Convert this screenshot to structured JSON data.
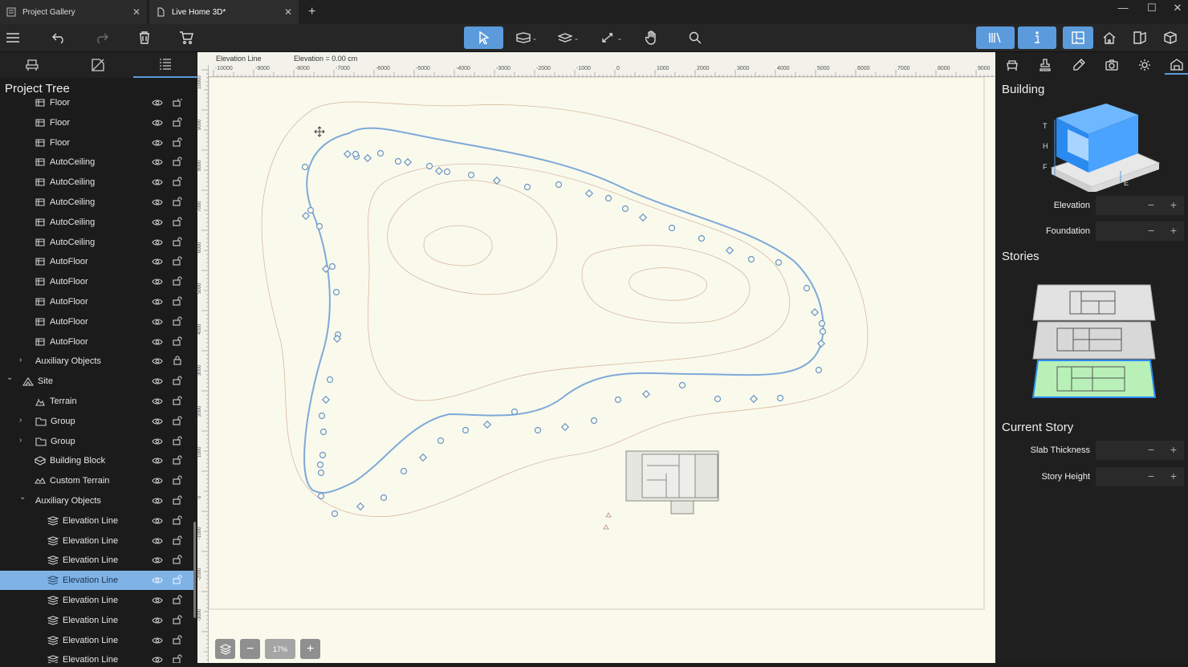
{
  "tabs": [
    {
      "label": "Project Gallery",
      "icon": "gallery-icon"
    },
    {
      "label": "Live Home 3D*",
      "icon": "document-icon"
    }
  ],
  "toolbar": {
    "items": [
      "menu-icon",
      "undo-icon",
      "redo-icon",
      "trash-icon",
      "cart-icon",
      "select-pointer-icon",
      "wall-tool-icon",
      "floor-tool-icon",
      "dimension-tool-icon",
      "pan-hand-icon",
      "search-icon",
      "library-icon",
      "info-icon",
      "2d-plan-icon",
      "3d-house-icon",
      "split-view-icon",
      "3d-box-icon"
    ]
  },
  "left_panel": {
    "title": "Project Tree",
    "tree": [
      {
        "label": "Floor",
        "indent": 2,
        "icon": "floor-icon",
        "expander": "",
        "lock": "unlocked"
      },
      {
        "label": "Floor",
        "indent": 2,
        "icon": "floor-icon",
        "expander": "",
        "lock": "unlocked"
      },
      {
        "label": "Floor",
        "indent": 2,
        "icon": "floor-icon",
        "expander": "",
        "lock": "unlocked"
      },
      {
        "label": "AutoCeiling",
        "indent": 2,
        "icon": "floor-icon",
        "expander": "",
        "lock": "unlocked"
      },
      {
        "label": "AutoCeiling",
        "indent": 2,
        "icon": "floor-icon",
        "expander": "",
        "lock": "unlocked"
      },
      {
        "label": "AutoCeiling",
        "indent": 2,
        "icon": "floor-icon",
        "expander": "",
        "lock": "unlocked"
      },
      {
        "label": "AutoCeiling",
        "indent": 2,
        "icon": "floor-icon",
        "expander": "",
        "lock": "unlocked"
      },
      {
        "label": "AutoCeiling",
        "indent": 2,
        "icon": "floor-icon",
        "expander": "",
        "lock": "unlocked"
      },
      {
        "label": "AutoFloor",
        "indent": 2,
        "icon": "floor-icon",
        "expander": "",
        "lock": "unlocked"
      },
      {
        "label": "AutoFloor",
        "indent": 2,
        "icon": "floor-icon",
        "expander": "",
        "lock": "unlocked"
      },
      {
        "label": "AutoFloor",
        "indent": 2,
        "icon": "floor-icon",
        "expander": "",
        "lock": "unlocked"
      },
      {
        "label": "AutoFloor",
        "indent": 2,
        "icon": "floor-icon",
        "expander": "",
        "lock": "unlocked"
      },
      {
        "label": "AutoFloor",
        "indent": 2,
        "icon": "floor-icon",
        "expander": "",
        "lock": "unlocked"
      },
      {
        "label": "Auxiliary Objects",
        "indent": 1,
        "icon": "",
        "expander": "›",
        "lock": "locked"
      },
      {
        "label": "Site",
        "indent": 0,
        "icon": "site-icon",
        "expander": "⌄",
        "lock": "unlocked"
      },
      {
        "label": "Terrain",
        "indent": 2,
        "icon": "terrain-icon",
        "expander": "",
        "lock": "unlocked"
      },
      {
        "label": "Group",
        "indent": 1,
        "icon": "folder-icon",
        "expander": "›",
        "lock": "unlocked"
      },
      {
        "label": "Group",
        "indent": 1,
        "icon": "folder-icon",
        "expander": "›",
        "lock": "unlocked"
      },
      {
        "label": "Building Block",
        "indent": 2,
        "icon": "building-block-icon",
        "expander": "",
        "lock": "unlocked"
      },
      {
        "label": "Custom Terrain",
        "indent": 2,
        "icon": "custom-terrain-icon",
        "expander": "",
        "lock": "unlocked"
      },
      {
        "label": "Auxiliary Objects",
        "indent": 1,
        "icon": "",
        "expander": "⌄",
        "lock": "unlocked"
      },
      {
        "label": "Elevation Line",
        "indent": 3,
        "icon": "elevation-line-icon",
        "expander": "",
        "lock": "unlocked"
      },
      {
        "label": "Elevation Line",
        "indent": 3,
        "icon": "elevation-line-icon",
        "expander": "",
        "lock": "unlocked"
      },
      {
        "label": "Elevation Line",
        "indent": 3,
        "icon": "elevation-line-icon",
        "expander": "",
        "lock": "unlocked"
      },
      {
        "label": "Elevation Line",
        "indent": 3,
        "icon": "elevation-line-icon",
        "expander": "",
        "lock": "unlocked",
        "selected": true
      },
      {
        "label": "Elevation Line",
        "indent": 3,
        "icon": "elevation-line-icon",
        "expander": "",
        "lock": "unlocked"
      },
      {
        "label": "Elevation Line",
        "indent": 3,
        "icon": "elevation-line-icon",
        "expander": "",
        "lock": "unlocked"
      },
      {
        "label": "Elevation Line",
        "indent": 3,
        "icon": "elevation-line-icon",
        "expander": "",
        "lock": "unlocked"
      },
      {
        "label": "Elevation Line",
        "indent": 3,
        "icon": "elevation-line-icon",
        "expander": "",
        "lock": "unlocked"
      }
    ]
  },
  "canvas": {
    "selection_name": "Elevation Line",
    "elevation_readout": "Elevation = 0.00 cm",
    "ruler_units": "cm",
    "h_ticks": [
      "-10000",
      "-9000",
      "-8000",
      "-7000",
      "-6000",
      "-5000",
      "-4000",
      "-3000",
      "-2000",
      "-1000",
      "0",
      "1000",
      "2000",
      "3000",
      "4000",
      "5000",
      "6000",
      "7000",
      "8000",
      "9000"
    ],
    "v_ticks": [
      "10000",
      "9000",
      "8000",
      "7000",
      "6000",
      "5000",
      "4000",
      "3000",
      "2000",
      "1000",
      "0",
      "-1000",
      "-2000",
      "-3000"
    ],
    "zoom": "17%"
  },
  "right_panel": {
    "building_title": "Building",
    "building_diagram_labels": [
      "T",
      "H",
      "F",
      "E"
    ],
    "elevation_label": "Elevation",
    "foundation_label": "Foundation",
    "stories_title": "Stories",
    "current_story_title": "Current Story",
    "slab_label": "Slab Thickness",
    "story_height_label": "Story Height",
    "minus": "−",
    "plus": "+"
  },
  "colors": {
    "accent": "#5b9bdb",
    "selection_row": "#7fb3e6",
    "canvas_bg": "#f9faec",
    "elevation_line": "#7fa9d9",
    "contour": "#d9b8a0"
  }
}
